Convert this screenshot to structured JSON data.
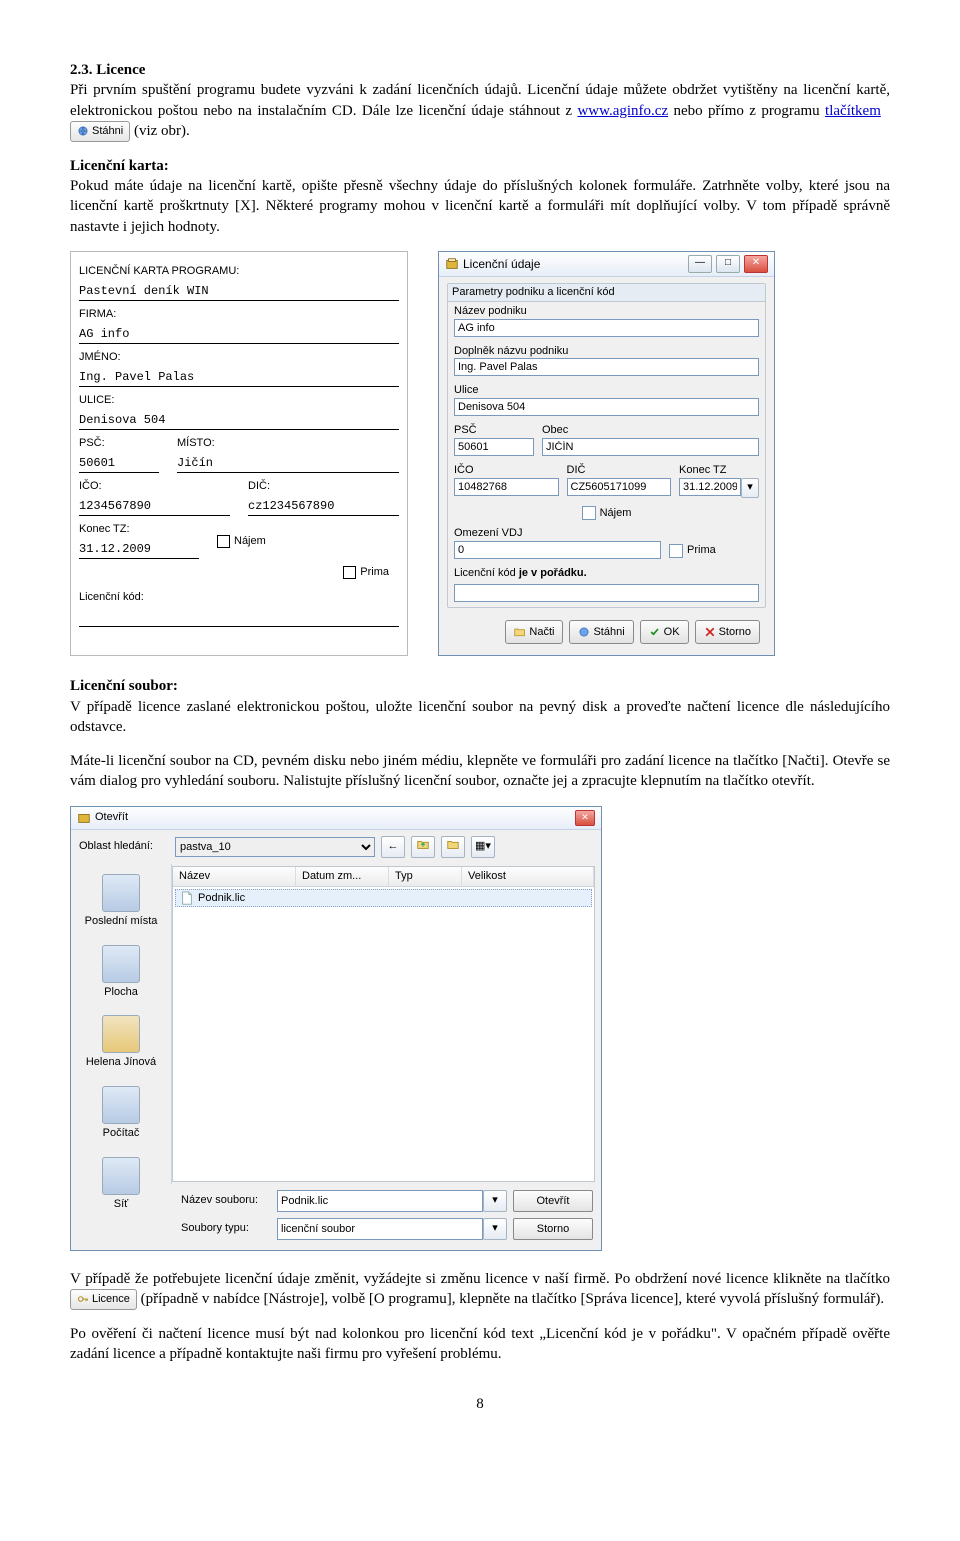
{
  "section": {
    "title": "2.3. Licence",
    "para1": "Při prvním spuštění programu budete vyzváni k zadání licenčních údajů. Licenční údaje můžete obdržet vytištěny na licenční kartě, elektronickou poštou nebo na instalačním CD. Dále lze licenční údaje stáhnout z ",
    "link1_text": "www.aginfo.cz",
    "para1b": " nebo přímo z programu ",
    "link2_text": "tlačítkem",
    "btn_stahni": "Stáhni",
    "para1c": " (viz obr).",
    "h_card": "Licenční karta:",
    "para2": "Pokud máte údaje na licenční kartě, opište přesně všechny údaje do příslušných kolonek formuláře. Zatrhněte volby, které jsou na licenční kartě proškrtnuty [X]. Některé programy mohou v licenční kartě a formuláři mít doplňující volby. V tom případě správně nastavte i jejich hodnoty.",
    "h_file": "Licenční soubor:",
    "para3": "V případě licence zaslané elektronickou poštou, uložte licenční soubor na pevný disk a proveďte načtení licence dle následujícího odstavce.",
    "para4": "Máte-li licenční soubor na CD, pevném disku nebo jiném médiu, klepněte ve formuláři pro zadání licence na tlačítko [Načti]. Otevře se vám dialog pro vyhledání souboru. Nalistujte příslušný licenční soubor, označte jej a zpracujte klepnutím na tlačítko otevřít.",
    "para5a": "V případě že potřebujete licenční údaje změnit, vyžádejte si změnu licence v naší firmě. Po obdržení nové licence klikněte na tlačítko ",
    "btn_licence": "Licence",
    "para5b": " (případně v nabídce [Nástroje], volbě [O programu], klepněte na tlačítko [Správa licence], které vyvolá příslušný formulář).",
    "para6": "Po ověření či načtení licence musí být nad kolonkou pro licenční kód text „Licenční kód je v pořádku\". V opačném případě ověřte zadání licence a případně kontaktujte naši firmu pro vyřešení problému."
  },
  "card": {
    "title": "LICENČNÍ KARTA PROGRAMU:",
    "program": "Pastevní deník WIN",
    "lbl_firma": "FIRMA:",
    "firma": "AG info",
    "lbl_jmeno": "JMÉNO:",
    "jmeno": "Ing. Pavel Palas",
    "lbl_ulice": "ULICE:",
    "ulice": "Denisova 504",
    "lbl_psc": "PSČ:",
    "lbl_misto": "MÍSTO:",
    "psc": "50601",
    "misto": "Jičín",
    "lbl_ico": "IČO:",
    "lbl_dic": "DIČ:",
    "ico": "1234567890",
    "dic": "cz1234567890",
    "lbl_konec": "Konec TZ:",
    "konec": "31.12.2009",
    "lbl_najem": "Nájem",
    "lbl_prima": "Prima",
    "lbl_kod": "Licenční kód:"
  },
  "dialog": {
    "title": "Licenční údaje",
    "grp1": "Parametry podniku a licenční kód",
    "lbl_nazev": "Název podniku",
    "nazev": "AG info",
    "lbl_doplnek": "Doplněk názvu podniku",
    "doplnek": "Ing. Pavel Palas",
    "lbl_ulice": "Ulice",
    "ulice": "Denisova 504",
    "lbl_psc": "PSČ",
    "psc": "50601",
    "lbl_obec": "Obec",
    "obec": "JIČÍN",
    "lbl_ico": "IČO",
    "ico": "10482768",
    "lbl_dic": "DIČ",
    "dic": "CZ5605171099",
    "lbl_konec": "Konec TZ",
    "konec": "31.12.2009",
    "chk_najem": "Nájem",
    "lbl_omez": "Omezení VDJ",
    "omez": "0",
    "chk_prima": "Prima",
    "lbl_kod": "Licenční kód",
    "kod_status": "je v pořádku.",
    "btn_nacti": "Načti",
    "btn_stahni": "Stáhni",
    "btn_ok": "OK",
    "btn_storno": "Storno"
  },
  "open": {
    "title": "Otevřít",
    "lbl_oblast": "Oblast hledání:",
    "folder": "pastva_10",
    "col_nazev": "Název",
    "col_datum": "Datum zm...",
    "col_typ": "Typ",
    "col_velikost": "Velikost",
    "file": "Podnik.lic",
    "places": {
      "p1": "Poslední místa",
      "p2": "Plocha",
      "p3": "Helena Jínová",
      "p4": "Počítač",
      "p5": "Síť"
    },
    "lbl_nazev_s": "Název souboru:",
    "nazev_s": "Podnik.lic",
    "lbl_typy": "Soubory typu:",
    "typy": "licenční soubor",
    "btn_open": "Otevřít",
    "btn_storno": "Storno"
  },
  "pagenum": "8"
}
